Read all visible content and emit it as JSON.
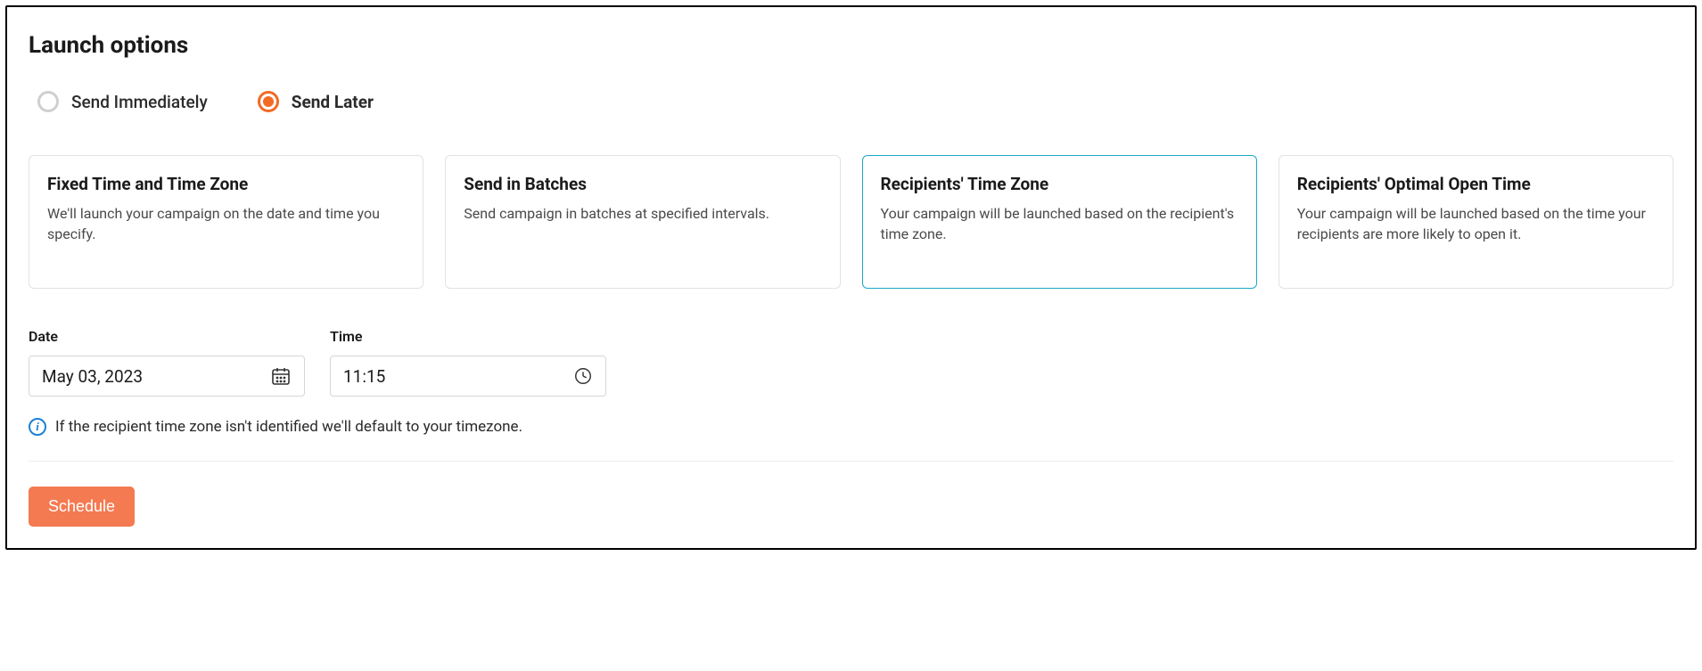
{
  "title": "Launch options",
  "radios": {
    "immediate": "Send Immediately",
    "later": "Send Later"
  },
  "cards": [
    {
      "title": "Fixed Time and Time Zone",
      "desc": "We'll launch your campaign on the date and time you specify."
    },
    {
      "title": "Send in Batches",
      "desc": "Send campaign in batches at specified intervals."
    },
    {
      "title": "Recipients' Time Zone",
      "desc": "Your campaign will be launched based on the recipient's time zone."
    },
    {
      "title": "Recipients' Optimal Open Time",
      "desc": "Your campaign will be launched based on the time your recipients are more likely to open it."
    }
  ],
  "fields": {
    "date_label": "Date",
    "date_value": "May 03, 2023",
    "time_label": "Time",
    "time_value": "11:15"
  },
  "info_text": "If the recipient time zone isn't identified we'll default to your timezone.",
  "schedule_btn": "Schedule"
}
